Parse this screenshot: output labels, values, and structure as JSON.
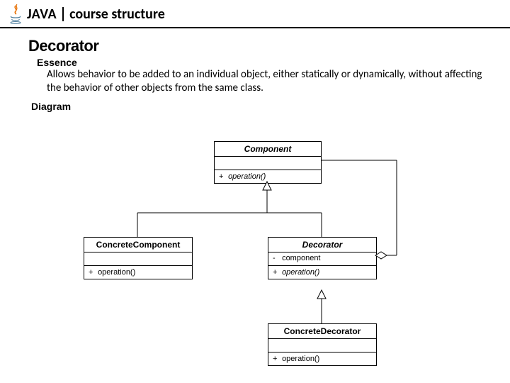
{
  "header": {
    "brand": "JAVA",
    "subtitle": "course structure"
  },
  "page": {
    "title": "Decorator",
    "essence_heading": "Essence",
    "essence_text": "Allows behavior to be added to an individual object, either statically or dynamically, without affecting the behavior of other objects from the same class.",
    "diagram_heading": "Diagram"
  },
  "uml": {
    "component": {
      "name": "Component",
      "op_vis": "+",
      "op": "operation()"
    },
    "concrete_component": {
      "name": "ConcreteComponent",
      "op_vis": "+",
      "op": "operation()"
    },
    "decorator": {
      "name": "Decorator",
      "attr_vis": "-",
      "attr": "component",
      "op_vis": "+",
      "op": "operation()"
    },
    "concrete_decorator": {
      "name": "ConcreteDecorator",
      "op_vis": "+",
      "op": "operation()"
    }
  },
  "relations": {
    "cc_to_component": "generalization",
    "decorator_to_component_inherit": "generalization",
    "decorator_to_component_aggregate": "aggregation",
    "cd_to_decorator": "generalization"
  }
}
